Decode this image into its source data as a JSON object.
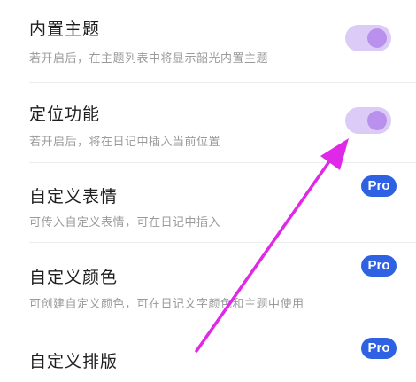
{
  "settings": {
    "items": [
      {
        "title": "内置主题",
        "description": "若开启后，在主题列表中将显示韶光内置主题",
        "toggle_on": true
      },
      {
        "title": "定位功能",
        "description": "若开启后，将在日记中插入当前位置",
        "toggle_on": true
      },
      {
        "title": "自定义表情",
        "description": "可传入自定义表情，可在日记中插入",
        "badge": "Pro"
      },
      {
        "title": "自定义颜色",
        "description": "可创建自定义颜色，可在日记文字颜色和主题中使用",
        "badge": "Pro"
      },
      {
        "title": "自定义排版",
        "badge": "Pro"
      }
    ]
  },
  "colors": {
    "toggle_track": "#dccbf6",
    "toggle_knob": "#b991ec",
    "pro_badge": "#2f62e3",
    "annotation_arrow": "#e028e8"
  }
}
